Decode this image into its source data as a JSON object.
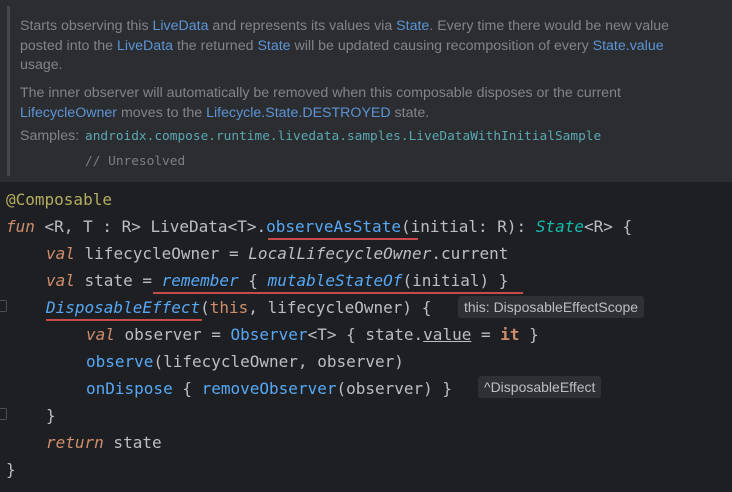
{
  "doc": {
    "para1": {
      "p1": "Starts observing this ",
      "l1": "LiveData",
      "p2": " and represents its values via ",
      "l2": "State",
      "p3": ". Every time there would be new value posted into the ",
      "l3": "LiveData",
      "p4": " the returned ",
      "l4": "State",
      "p5": " will be updated causing recomposition of every ",
      "l5": "State.value",
      "p6": " usage."
    },
    "para2": {
      "p1": "The inner observer will automatically be removed when this composable disposes or the current ",
      "l1": "LifecycleOwner",
      "p2": " moves to the ",
      "l2": "Lifecycle.State.DESTROYED",
      "p3": " state."
    },
    "samples_label": "Samples:",
    "samples_link": "androidx.compose.runtime.livedata.samples.LiveDataWithInitialSample",
    "samples_comment": "// Unresolved"
  },
  "code": {
    "annotation": "@Composable",
    "l2": {
      "fun": "fun",
      "g1": " <R, T : R> ",
      "recv": "LiveData<T>.",
      "name": "observeAsState",
      "open": "(initial: R): ",
      "ret": "State",
      "tail": "<R> {"
    },
    "l3": {
      "val": "val",
      "rest1": " lifecycleOwner = ",
      "local": "LocalLifecycleOwner",
      "rest2": ".current"
    },
    "l4": {
      "val": "val",
      "rest1": " state = ",
      "remember": "remember",
      "b1": " { ",
      "mut": "mutableStateOf",
      "args": "(initial) }"
    },
    "l5": {
      "de": "DisposableEffect",
      "a1": "(",
      "this": "this",
      "a2": ", lifecycleOwner) {"
    },
    "l6": {
      "val": "val",
      "rest1": " observer = ",
      "obs": "Observer",
      "gen": "<T>",
      "b1": " { state.",
      "value": "value",
      "eq": " = ",
      "it": "it",
      "b2": " }"
    },
    "l7": {
      "fn": "observe",
      "rest": "(lifecycleOwner, observer)"
    },
    "l8": {
      "fn": "onDispose",
      "b1": " { ",
      "rm": "removeObserver",
      "rest": "(observer) }"
    },
    "l9": "}",
    "l10": {
      "ret": "return",
      "rest": " state"
    },
    "l11": "}"
  },
  "hints": {
    "this_hint": "this: DisposableEffectScope",
    "dispose_hint": "^DisposableEffect"
  }
}
